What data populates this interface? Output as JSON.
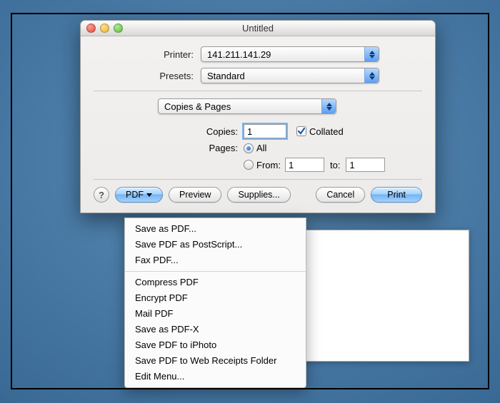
{
  "window": {
    "title": "Untitled"
  },
  "fields": {
    "printer_label": "Printer:",
    "printer_value": "141.211.141.29",
    "presets_label": "Presets:",
    "presets_value": "Standard",
    "section_value": "Copies & Pages",
    "copies_label": "Copies:",
    "copies_value": "1",
    "collated_label": "Collated",
    "collated_checked": true,
    "pages_label": "Pages:",
    "pages_all_label": "All",
    "pages_from_label": "From:",
    "pages_from_value": "1",
    "pages_to_label": "to:",
    "pages_to_value": "1",
    "pages_mode": "all"
  },
  "buttons": {
    "help": "?",
    "pdf": "PDF",
    "preview": "Preview",
    "supplies": "Supplies...",
    "cancel": "Cancel",
    "print": "Print"
  },
  "pdf_menu": {
    "group1": [
      "Save as PDF...",
      "Save PDF as PostScript...",
      "Fax PDF..."
    ],
    "group2": [
      "Compress PDF",
      "Encrypt PDF",
      "Mail PDF",
      "Save as PDF-X",
      "Save PDF to iPhoto",
      "Save PDF to Web Receipts Folder",
      "Edit Menu..."
    ]
  }
}
